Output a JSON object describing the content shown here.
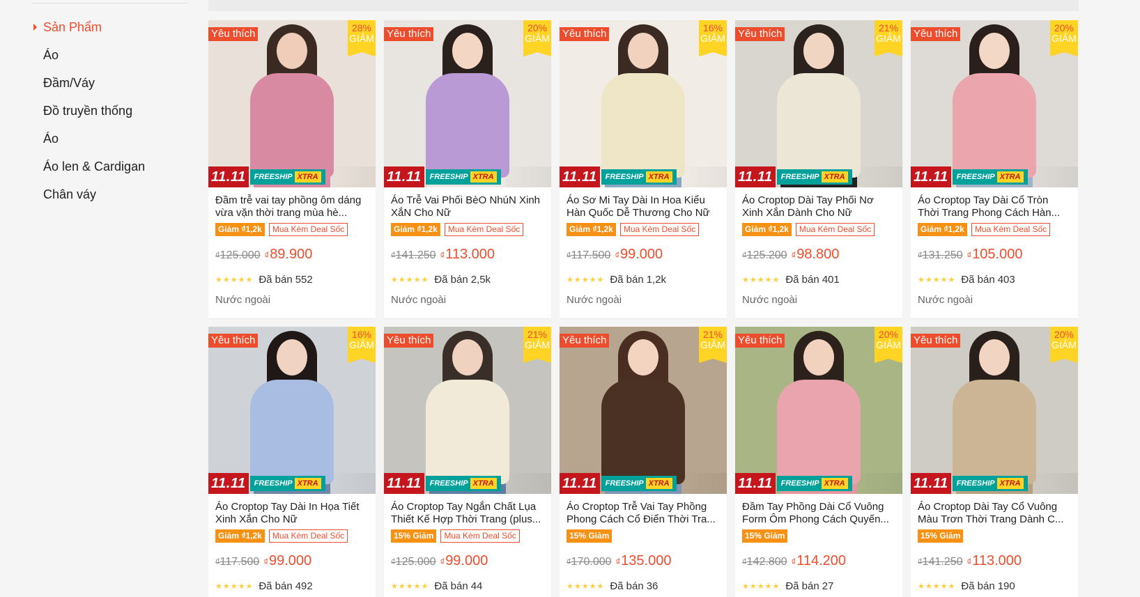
{
  "sidebar": {
    "items": [
      {
        "label": "Sản Phẩm",
        "active": true
      },
      {
        "label": "Áo"
      },
      {
        "label": "Đầm/Váy"
      },
      {
        "label": "Đồ truyền thống"
      },
      {
        "label": "Áo"
      },
      {
        "label": "Áo len & Cardigan"
      },
      {
        "label": "Chân váy"
      }
    ]
  },
  "common": {
    "fav_label": "Yêu thích",
    "giam_label": "GIẢM",
    "promo_1111": "11.11",
    "freeship": "FREESHIP",
    "xtra": "XTRA",
    "sold_prefix": "Đã bán",
    "currency": "₫",
    "origin": "Nước ngoài"
  },
  "colors": {
    "accent": "#ee4d2d",
    "badge_yellow": "#ffd424",
    "tag_orange": "#f69113",
    "star": "#ffce3d"
  },
  "products": [
    {
      "title": "Đầm trễ vai tay phồng ôm dáng vừa vặn thời trang mùa hè...",
      "discount": "28%",
      "tag1": "Giảm ₫1,2k",
      "tag2": "Mua Kèm Deal Sốc",
      "old_price": "125.000",
      "new_price": "89.900",
      "sold": "552",
      "show_origin": true,
      "img": {
        "bg": "#e9e1d9",
        "hair": "#3a2a22",
        "skin": "#f0cdb8",
        "top": "#d98aa3",
        "bottom": "#d98aa3"
      }
    },
    {
      "title": "Áo Trễ Vai Phối BèO NhúN Xinh XắN Cho Nữ",
      "discount": "20%",
      "tag1": "Giảm ₫1,2k",
      "tag2": "Mua Kèm Deal Sốc",
      "old_price": "141.250",
      "new_price": "113.000",
      "sold": "2,5k",
      "show_origin": true,
      "img": {
        "bg": "#e8e4df",
        "hair": "#2a201c",
        "skin": "#f3d6c4",
        "top": "#b99ad4",
        "bottom": "#ece8e3"
      }
    },
    {
      "title": "Áo Sơ Mi Tay Dài In Hoa Kiểu Hàn Quốc Dễ Thương Cho Nữ",
      "discount": "16%",
      "tag1": "Giảm ₫1,2k",
      "tag2": "Mua Kèm Deal Sốc",
      "old_price": "117.500",
      "new_price": "99.000",
      "sold": "1,2k",
      "show_origin": true,
      "img": {
        "bg": "#f1ece6",
        "hair": "#3b2a21",
        "skin": "#f0d2bf",
        "top": "#efe6c8",
        "bottom": "#8aa7c4"
      }
    },
    {
      "title": "Áo Croptop Dài Tay Phối Nơ Xinh Xắn Dành Cho Nữ",
      "discount": "21%",
      "tag1": "Giảm ₫1,2k",
      "tag2": "Mua Kèm Deal Sốc",
      "old_price": "125.200",
      "new_price": "98.800",
      "sold": "401",
      "show_origin": true,
      "img": {
        "bg": "#d9d6cf",
        "hair": "#2b211d",
        "skin": "#f1d5c3",
        "top": "#ece6d6",
        "bottom": "#222222"
      }
    },
    {
      "title": "Áo Croptop Tay Dài Cổ Tròn Thời Trang Phong Cách Hàn...",
      "discount": "20%",
      "tag1": "Giảm ₫1,2k",
      "tag2": "Mua Kèm Deal Sốc",
      "old_price": "131.250",
      "new_price": "105.000",
      "sold": "403",
      "show_origin": true,
      "img": {
        "bg": "#dedbd6",
        "hair": "#2a1f1a",
        "skin": "#f3d8c8",
        "top": "#eba6ad",
        "bottom": "#9fb3c9"
      }
    },
    {
      "title": "Áo Croptop Tay Dài In Họa Tiết Xinh Xắn Cho Nữ",
      "discount": "16%",
      "tag1": "Giảm ₫1,2k",
      "tag2": "Mua Kèm Deal Sốc",
      "old_price": "117.500",
      "new_price": "99.000",
      "sold": "492",
      "show_origin": false,
      "img": {
        "bg": "#cfd2d6",
        "hair": "#1f1816",
        "skin": "#f0d3c2",
        "top": "#a9bde2",
        "bottom": "#6f86a8"
      }
    },
    {
      "title": "Áo Croptop Tay Ngắn Chất Lụa Thiết Kế Hợp Thời Trang (plus...",
      "discount": "21%",
      "tag1": "15% Giảm",
      "tag2": "Mua Kèm Deal Sốc",
      "old_price": "125.000",
      "new_price": "99.000",
      "sold": "44",
      "show_origin": false,
      "img": {
        "bg": "#c5c4be",
        "hair": "#3a2f28",
        "skin": "#efd3c0",
        "top": "#f1ead8",
        "bottom": "#5f7ea3"
      }
    },
    {
      "title": "Áo Croptop Trễ Vai Tay Phồng Phong Cách Cổ Điển Thời Tra...",
      "discount": "21%",
      "tag1": "15% Giảm",
      "tag2": "",
      "old_price": "170.000",
      "new_price": "135.000",
      "sold": "36",
      "show_origin": false,
      "img": {
        "bg": "#b7a58f",
        "hair": "#4b2e22",
        "skin": "#f2d4c1",
        "top": "#4b3024",
        "bottom": "#7f95b3"
      }
    },
    {
      "title": "Đầm Tay Phồng Dài Cổ Vuông Form Ôm Phong Cách Quyến...",
      "discount": "20%",
      "tag1": "15% Giảm",
      "tag2": "",
      "old_price": "142.800",
      "new_price": "114.200",
      "sold": "27",
      "show_origin": false,
      "img": {
        "bg": "#a9b585",
        "hair": "#2d211b",
        "skin": "#f1d2be",
        "top": "#e9a4ad",
        "bottom": "#e596a1"
      }
    },
    {
      "title": "Áo Croptop Dài Tay Cổ Vuông Màu Trơn Thời Trang Dành C...",
      "discount": "20%",
      "tag1": "15% Giảm",
      "tag2": "",
      "old_price": "141.250",
      "new_price": "113.000",
      "sold": "190",
      "show_origin": false,
      "img": {
        "bg": "#cfccc5",
        "hair": "#2a201b",
        "skin": "#f1d4c2",
        "top": "#ccb594",
        "bottom": "#b9a07e"
      }
    }
  ]
}
